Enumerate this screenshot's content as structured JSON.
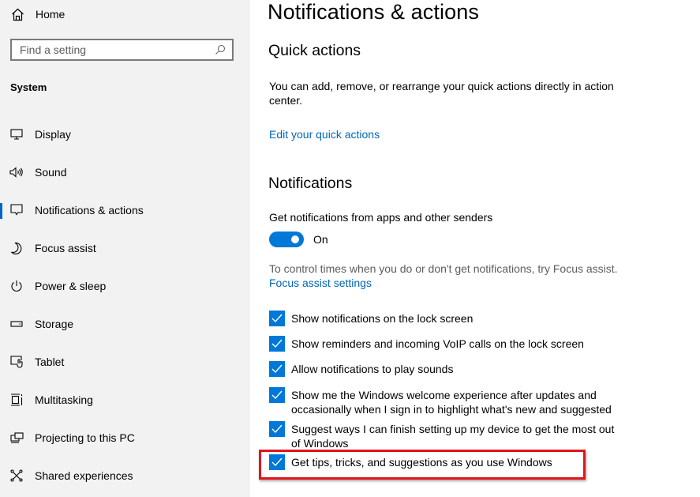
{
  "sidebar": {
    "home": {
      "label": "Home",
      "icon": "home-icon"
    },
    "search": {
      "placeholder": "Find a setting",
      "value": "",
      "icon": "search-icon"
    },
    "section_title": "System",
    "items": [
      {
        "label": "Display",
        "icon": "display-icon",
        "active": false
      },
      {
        "label": "Sound",
        "icon": "sound-icon",
        "active": false
      },
      {
        "label": "Notifications & actions",
        "icon": "notifications-icon",
        "active": true
      },
      {
        "label": "Focus assist",
        "icon": "moon-icon",
        "active": false
      },
      {
        "label": "Power & sleep",
        "icon": "power-icon",
        "active": false
      },
      {
        "label": "Storage",
        "icon": "storage-icon",
        "active": false
      },
      {
        "label": "Tablet",
        "icon": "tablet-icon",
        "active": false
      },
      {
        "label": "Multitasking",
        "icon": "multitasking-icon",
        "active": false
      },
      {
        "label": "Projecting to this PC",
        "icon": "projecting-icon",
        "active": false
      },
      {
        "label": "Shared experiences",
        "icon": "shared-experiences-icon",
        "active": false
      }
    ]
  },
  "main": {
    "title": "Notifications & actions",
    "quick_actions": {
      "heading": "Quick actions",
      "description": "You can add, remove, or rearrange your quick actions directly in action center.",
      "link": "Edit your quick actions"
    },
    "notifications": {
      "heading": "Notifications",
      "toggle_label": "Get notifications from apps and other senders",
      "toggle_state": "On",
      "toggle_on": true,
      "focus_hint": "To control times when you do or don't get notifications, try Focus assist.",
      "focus_link": "Focus assist settings",
      "checkboxes": [
        {
          "label": "Show notifications on the lock screen",
          "checked": true
        },
        {
          "label": "Show reminders and incoming VoIP calls on the lock screen",
          "checked": true
        },
        {
          "label": "Allow notifications to play sounds",
          "checked": true
        },
        {
          "label": "Show me the Windows welcome experience after updates and occasionally when I sign in to highlight what's new and suggested",
          "checked": true
        },
        {
          "label": "Suggest ways I can finish setting up my device to get the most out of Windows",
          "checked": true
        },
        {
          "label": "Get tips, tricks, and suggestions as you use Windows",
          "checked": true,
          "highlighted": true
        }
      ]
    }
  },
  "colors": {
    "accent": "#0078d7",
    "link": "#0067b8",
    "sidebar_bg": "#f2f2f2",
    "highlight_border": "#e0151b"
  }
}
